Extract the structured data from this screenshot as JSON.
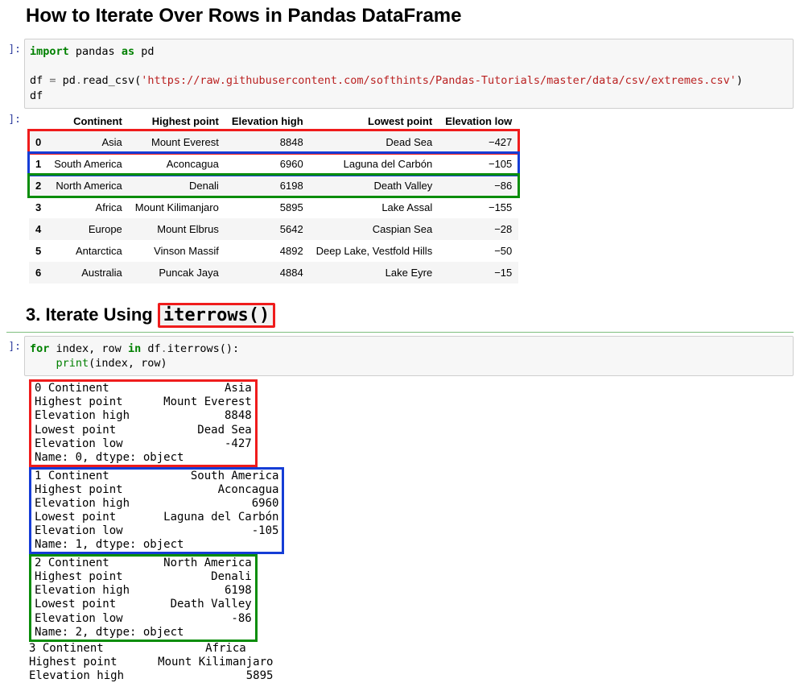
{
  "title": "How to Iterate Over Rows in Pandas DataFrame",
  "code1": {
    "line1_import": "import",
    "line1_pandas": " pandas ",
    "line1_as": "as",
    "line1_pd": " pd",
    "line3_pre": "df ",
    "line3_eq": "=",
    "line3_mid": " pd",
    "line3_dot": ".",
    "line3_fn": "read_csv(",
    "line3_str": "'https://raw.githubusercontent.com/softhints/Pandas-Tutorials/master/data/csv/extremes.csv'",
    "line3_close": ")",
    "line4": "df"
  },
  "prompt_in": "]:",
  "prompt_out": "]:",
  "table": {
    "headers": [
      "",
      "Continent",
      "Highest point",
      "Elevation high",
      "Lowest point",
      "Elevation low"
    ],
    "rows": [
      {
        "idx": "0",
        "c": "Asia",
        "hp": "Mount Everest",
        "eh": "8848",
        "lp": "Dead Sea",
        "el": "−427",
        "hl": "red"
      },
      {
        "idx": "1",
        "c": "South America",
        "hp": "Aconcagua",
        "eh": "6960",
        "lp": "Laguna del Carbón",
        "el": "−105",
        "hl": "blue"
      },
      {
        "idx": "2",
        "c": "North America",
        "hp": "Denali",
        "eh": "6198",
        "lp": "Death Valley",
        "el": "−86",
        "hl": "green"
      },
      {
        "idx": "3",
        "c": "Africa",
        "hp": "Mount Kilimanjaro",
        "eh": "5895",
        "lp": "Lake Assal",
        "el": "−155"
      },
      {
        "idx": "4",
        "c": "Europe",
        "hp": "Mount Elbrus",
        "eh": "5642",
        "lp": "Caspian Sea",
        "el": "−28"
      },
      {
        "idx": "5",
        "c": "Antarctica",
        "hp": "Vinson Massif",
        "eh": "4892",
        "lp": "Deep Lake, Vestfold Hills",
        "el": "−50"
      },
      {
        "idx": "6",
        "c": "Australia",
        "hp": "Puncak Jaya",
        "eh": "4884",
        "lp": "Lake Eyre",
        "el": "−15"
      }
    ]
  },
  "sub_heading_pre": "3. Iterate Using ",
  "sub_heading_code": "iterrows()",
  "code2": {
    "for": "for",
    "vars": " index, row ",
    "in": "in",
    "expr": " df",
    "dot": ".",
    "method": "iterrows():",
    "indent": "    ",
    "print": "print",
    "args": "(index, row)"
  },
  "output_blocks": [
    {
      "hl": "red",
      "text": "0 Continent                 Asia\nHighest point      Mount Everest\nElevation high              8848\nLowest point            Dead Sea\nElevation low               -427\nName: 0, dtype: object"
    },
    {
      "hl": "blue",
      "text": "1 Continent            South America\nHighest point              Aconcagua\nElevation high                  6960\nLowest point       Laguna del Carbón\nElevation low                   -105\nName: 1, dtype: object"
    },
    {
      "hl": "green",
      "text": "2 Continent        North America\nHighest point             Denali\nElevation high              6198\nLowest point        Death Valley\nElevation low                -86\nName: 2, dtype: object"
    },
    {
      "text": "3 Continent               Africa\nHighest point      Mount Kilimanjaro\nElevation high                  5895"
    }
  ],
  "chart_data": {
    "type": "table",
    "title": "Continent Extremes",
    "columns": [
      "Continent",
      "Highest point",
      "Elevation high",
      "Lowest point",
      "Elevation low"
    ],
    "rows": [
      [
        "Asia",
        "Mount Everest",
        8848,
        "Dead Sea",
        -427
      ],
      [
        "South America",
        "Aconcagua",
        6960,
        "Laguna del Carbón",
        -105
      ],
      [
        "North America",
        "Denali",
        6198,
        "Death Valley",
        -86
      ],
      [
        "Africa",
        "Mount Kilimanjaro",
        5895,
        "Lake Assal",
        -155
      ],
      [
        "Europe",
        "Mount Elbrus",
        5642,
        "Caspian Sea",
        -28
      ],
      [
        "Antarctica",
        "Vinson Massif",
        4892,
        "Deep Lake, Vestfold Hills",
        -50
      ],
      [
        "Australia",
        "Puncak Jaya",
        4884,
        "Lake Eyre",
        -15
      ]
    ]
  }
}
